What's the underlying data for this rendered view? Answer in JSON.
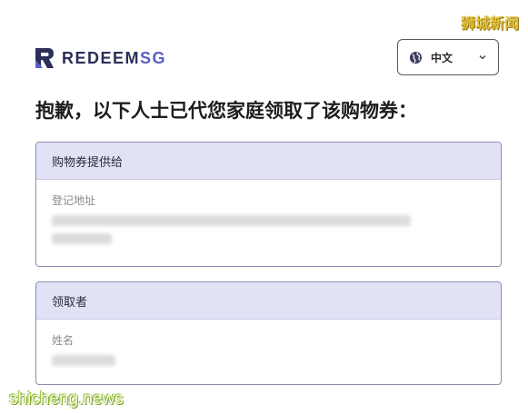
{
  "watermark_top": "狮城新闻",
  "watermark_bottom": "shicheng.news",
  "logo": {
    "text_main": "REDEEM",
    "text_accent": "SG",
    "brand_color": "#2c2f5a",
    "accent_color": "#5b60c4"
  },
  "language_select": {
    "selected": "中文",
    "icon": "globe-icon",
    "chevron": "chevron-down-icon"
  },
  "title": "抱歉，以下人士已代您家庭领取了该购物券：",
  "cards": [
    {
      "header": "购物券提供给",
      "field_label": "登记地址"
    },
    {
      "header": "领取者",
      "field_label": "姓名"
    }
  ],
  "colors": {
    "card_header_bg": "#e2e2f6",
    "card_border": "#8c8db3"
  }
}
